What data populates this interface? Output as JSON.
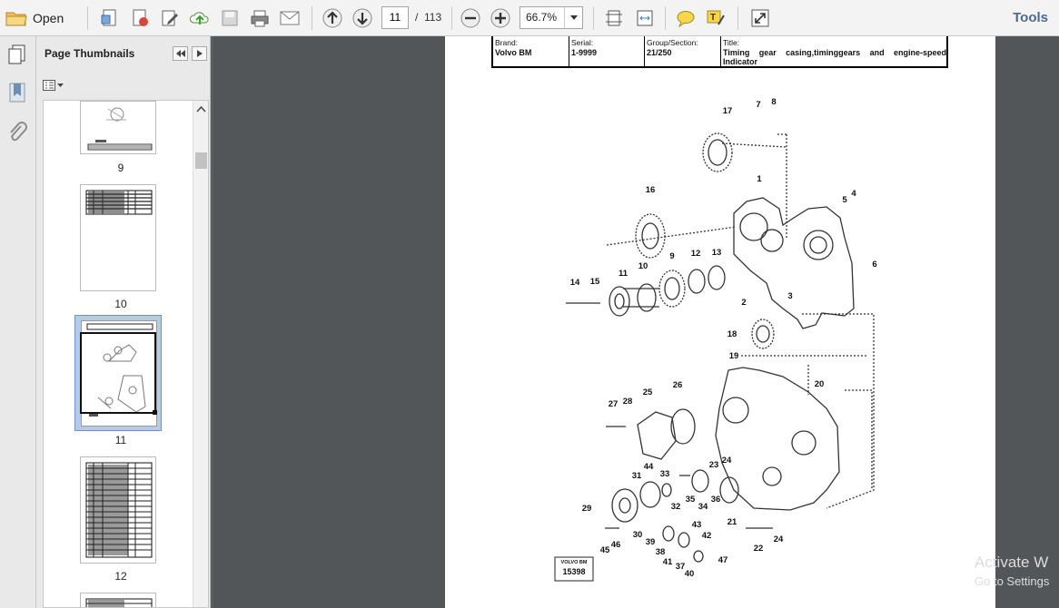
{
  "toolbar": {
    "open_label": "Open",
    "current_page": "11",
    "page_separator": "/",
    "total_pages": "113",
    "zoom": "66.7%",
    "tools_label": "Tools"
  },
  "panel": {
    "title": "Page Thumbnails",
    "thumbnails": [
      {
        "label": "9"
      },
      {
        "label": "10"
      },
      {
        "label": "11"
      },
      {
        "label": "12"
      }
    ]
  },
  "document": {
    "brand_label": "Brand:",
    "brand_value": "Volvo BM",
    "serial_label": "Serial:",
    "serial_value": "1-9999",
    "group_label": "Group/Section:",
    "group_value": "21/250",
    "title_label": "Title:",
    "title_value_1": "Timing gear casing,timinggears and engine-speed",
    "title_value_2": "Indicator",
    "stamp_line1": "VOLVO BM",
    "stamp_number": "15398",
    "part_numbers": [
      "1",
      "2",
      "3",
      "4",
      "5",
      "6",
      "7",
      "8",
      "9",
      "10",
      "11",
      "12",
      "13",
      "14",
      "15",
      "16",
      "17",
      "18",
      "19",
      "20",
      "21",
      "22",
      "23",
      "24",
      "25",
      "26",
      "27",
      "28",
      "29",
      "30",
      "31",
      "32",
      "33",
      "34",
      "35",
      "36",
      "37",
      "38",
      "39",
      "40",
      "41",
      "42",
      "43",
      "44",
      "45",
      "46",
      "47"
    ],
    "part_24b": "24"
  },
  "watermark": {
    "line1": "Activate W",
    "line2": "Go to Settings"
  }
}
